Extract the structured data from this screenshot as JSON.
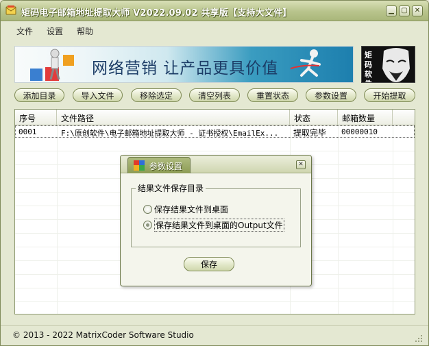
{
  "window": {
    "title": "矩码电子邮箱地址提取大师 V2022.09.02 共享版【支持大文件】",
    "controls": {
      "minimize": "▁",
      "maximize": "▢",
      "close": "✕"
    }
  },
  "menu": {
    "items": [
      "文件",
      "设置",
      "帮助"
    ]
  },
  "banner": {
    "text": "网络营销  让产品更具价值",
    "logo_text": "矩码软件"
  },
  "toolbar": {
    "buttons": [
      "添加目录",
      "导入文件",
      "移除选定",
      "清空列表",
      "重置状态",
      "参数设置",
      "开始提取"
    ]
  },
  "table": {
    "columns": [
      "序号",
      "文件路径",
      "状态",
      "邮箱数量"
    ],
    "rows": [
      {
        "index": "0001",
        "path": "F:\\原创软件\\电子邮箱地址提取大师 - 证书授权\\EmailEx...",
        "status": "提取完毕",
        "count": "00000010"
      }
    ]
  },
  "dialog": {
    "title": "参数设置",
    "close": "✕",
    "group_label": "结果文件保存目录",
    "options": [
      {
        "label": "保存结果文件到桌面",
        "checked": false
      },
      {
        "label": "保存结果文件到桌面的Output文件",
        "checked": true
      }
    ],
    "save_label": "保存"
  },
  "status": {
    "text": "© 2013 - 2022  MatrixCoder Software Studio"
  },
  "icons": {
    "app": "app-icon",
    "dialog": "settings-icon",
    "grip": "resize-grip-icon"
  },
  "colors": {
    "titlebar": "#b8c48c",
    "window_bg": "#e4e8d2",
    "dialog_tab": "#8d9c55",
    "banner_text": "#1b3c66"
  }
}
